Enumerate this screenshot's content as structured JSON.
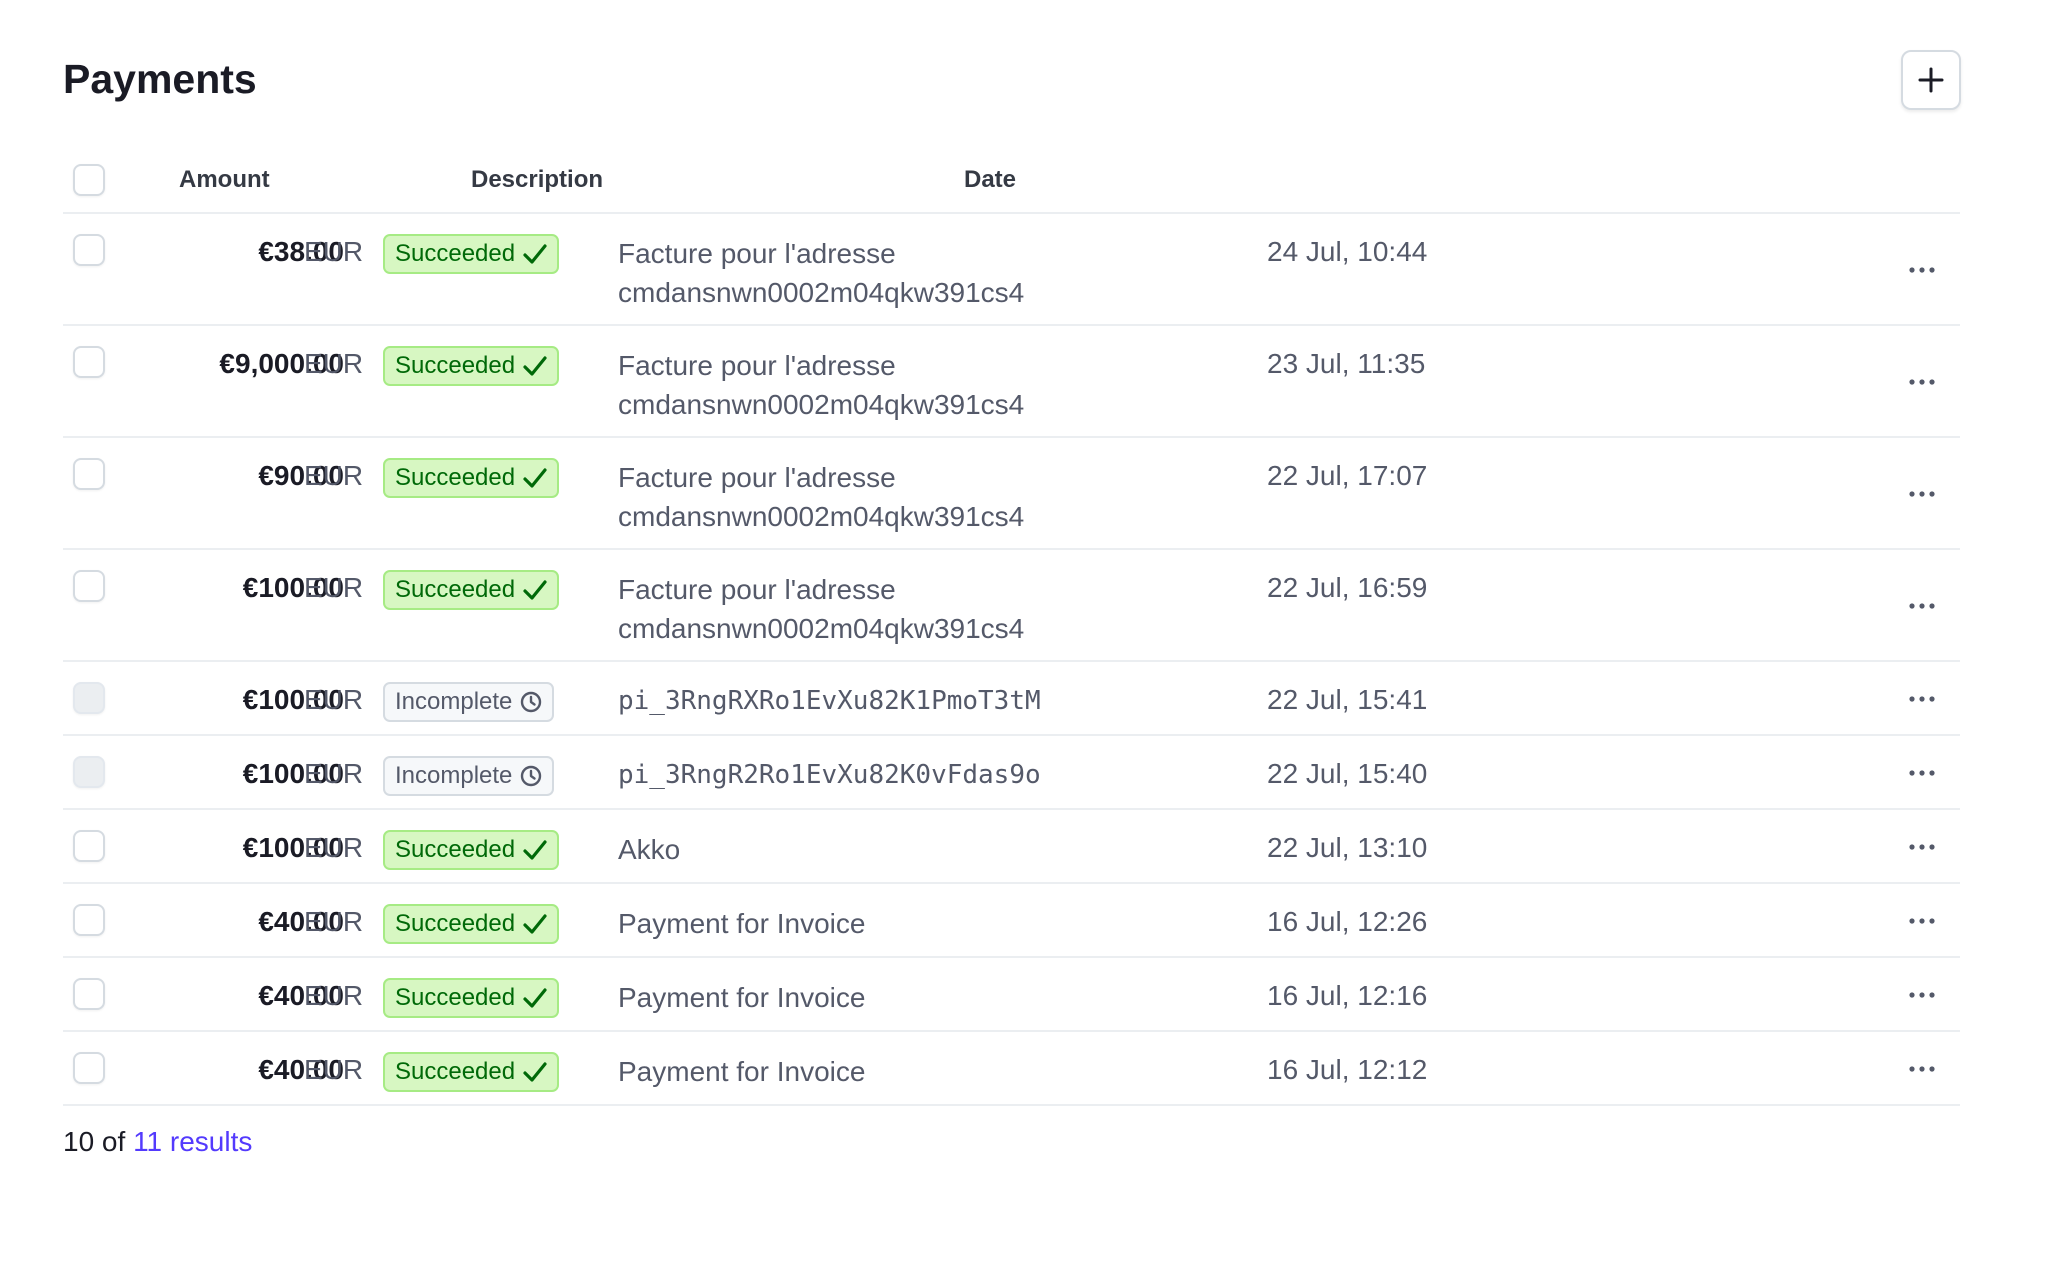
{
  "page": {
    "title": "Payments",
    "add_button_label": "+"
  },
  "columns": {
    "amount": "Amount",
    "description": "Description",
    "date": "Date"
  },
  "rows": [
    {
      "amount": "€38.00",
      "currency": "EUR",
      "status": "Succeeded",
      "description": "Facture pour l'adresse cmdansnwn0002m04qkw391cs4",
      "date": "24 Jul, 10:44"
    },
    {
      "amount": "€9,000.00",
      "currency": "EUR",
      "status": "Succeeded",
      "description": "Facture pour l'adresse cmdansnwn0002m04qkw391cs4",
      "date": "23 Jul, 11:35"
    },
    {
      "amount": "€90.00",
      "currency": "EUR",
      "status": "Succeeded",
      "description": "Facture pour l'adresse cmdansnwn0002m04qkw391cs4",
      "date": "22 Jul, 17:07"
    },
    {
      "amount": "€100.00",
      "currency": "EUR",
      "status": "Succeeded",
      "description": "Facture pour l'adresse cmdansnwn0002m04qkw391cs4",
      "date": "22 Jul, 16:59"
    },
    {
      "amount": "€100.00",
      "currency": "EUR",
      "status": "Incomplete",
      "description": "pi_3RngRXRo1EvXu82K1PmoT3tM",
      "date": "22 Jul, 15:41"
    },
    {
      "amount": "€100.00",
      "currency": "EUR",
      "status": "Incomplete",
      "description": "pi_3RngR2Ro1EvXu82K0vFdas9o",
      "date": "22 Jul, 15:40"
    },
    {
      "amount": "€100.00",
      "currency": "EUR",
      "status": "Succeeded",
      "description": "Akko",
      "date": "22 Jul, 13:10"
    },
    {
      "amount": "€40.00",
      "currency": "EUR",
      "status": "Succeeded",
      "description": "Payment for Invoice",
      "date": "16 Jul, 12:26"
    },
    {
      "amount": "€40.00",
      "currency": "EUR",
      "status": "Succeeded",
      "description": "Payment for Invoice",
      "date": "16 Jul, 12:16"
    },
    {
      "amount": "€40.00",
      "currency": "EUR",
      "status": "Succeeded",
      "description": "Payment for Invoice",
      "date": "16 Jul, 12:12"
    }
  ],
  "footer": {
    "count_text": "10 of ",
    "link_text": "11 results"
  },
  "colors": {
    "success": "#006908",
    "link": "#533afd"
  }
}
